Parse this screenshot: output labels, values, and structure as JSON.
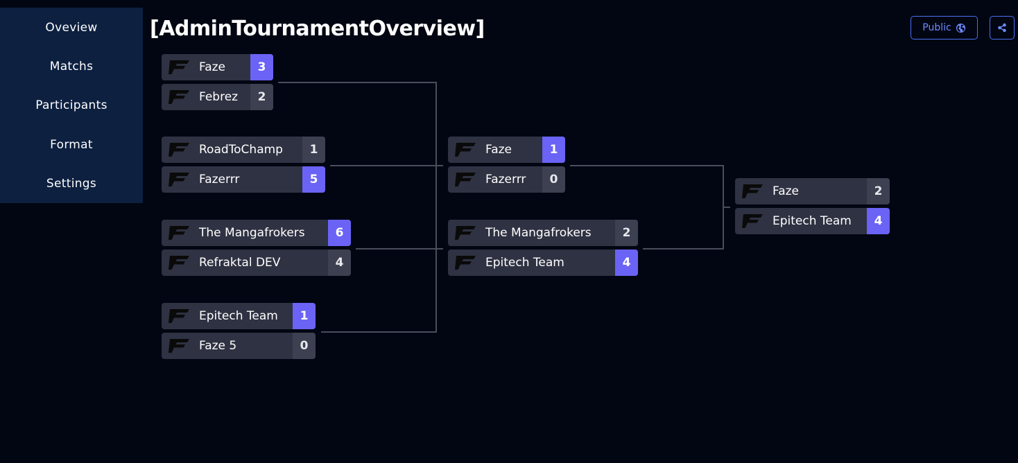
{
  "sidebar": {
    "items": [
      {
        "label": "Oveview"
      },
      {
        "label": "Matchs"
      },
      {
        "label": "Participants"
      },
      {
        "label": "Format"
      },
      {
        "label": "Settings"
      }
    ]
  },
  "header": {
    "title": "[AdminTournamentOverview]",
    "public_label": "Public",
    "public_icon": "globe-icon",
    "share_icon": "share-icon"
  },
  "colors": {
    "background": "#020612",
    "sidebar": "#0d2040",
    "row": "#2f3242",
    "score": "#3d4050",
    "winner_score": "#6a63f5",
    "accent_border": "#4c6ff5"
  },
  "team_logo_icon": "faze-clan-logo-icon",
  "bracket": {
    "rounds": [
      {
        "matches": [
          {
            "teams": [
              {
                "name": "Faze",
                "score": "3",
                "winner": true
              },
              {
                "name": "Febrez",
                "score": "2",
                "winner": false
              }
            ]
          },
          {
            "teams": [
              {
                "name": "RoadToChamp",
                "score": "1",
                "winner": false
              },
              {
                "name": "Fazerrr",
                "score": "5",
                "winner": true
              }
            ]
          },
          {
            "teams": [
              {
                "name": "The Mangafrokers",
                "score": "6",
                "winner": true
              },
              {
                "name": "Refraktal DEV",
                "score": "4",
                "winner": false
              }
            ]
          },
          {
            "teams": [
              {
                "name": "Epitech Team",
                "score": "1",
                "winner": true
              },
              {
                "name": "Faze 5",
                "score": "0",
                "winner": false
              }
            ]
          }
        ]
      },
      {
        "matches": [
          {
            "teams": [
              {
                "name": "Faze",
                "score": "1",
                "winner": true
              },
              {
                "name": "Fazerrr",
                "score": "0",
                "winner": false
              }
            ]
          },
          {
            "teams": [
              {
                "name": "The Mangafrokers",
                "score": "2",
                "winner": false
              },
              {
                "name": "Epitech Team",
                "score": "4",
                "winner": true
              }
            ]
          }
        ]
      },
      {
        "matches": [
          {
            "teams": [
              {
                "name": "Faze",
                "score": "2",
                "winner": false
              },
              {
                "name": "Epitech Team",
                "score": "4",
                "winner": true
              }
            ]
          }
        ]
      }
    ]
  }
}
